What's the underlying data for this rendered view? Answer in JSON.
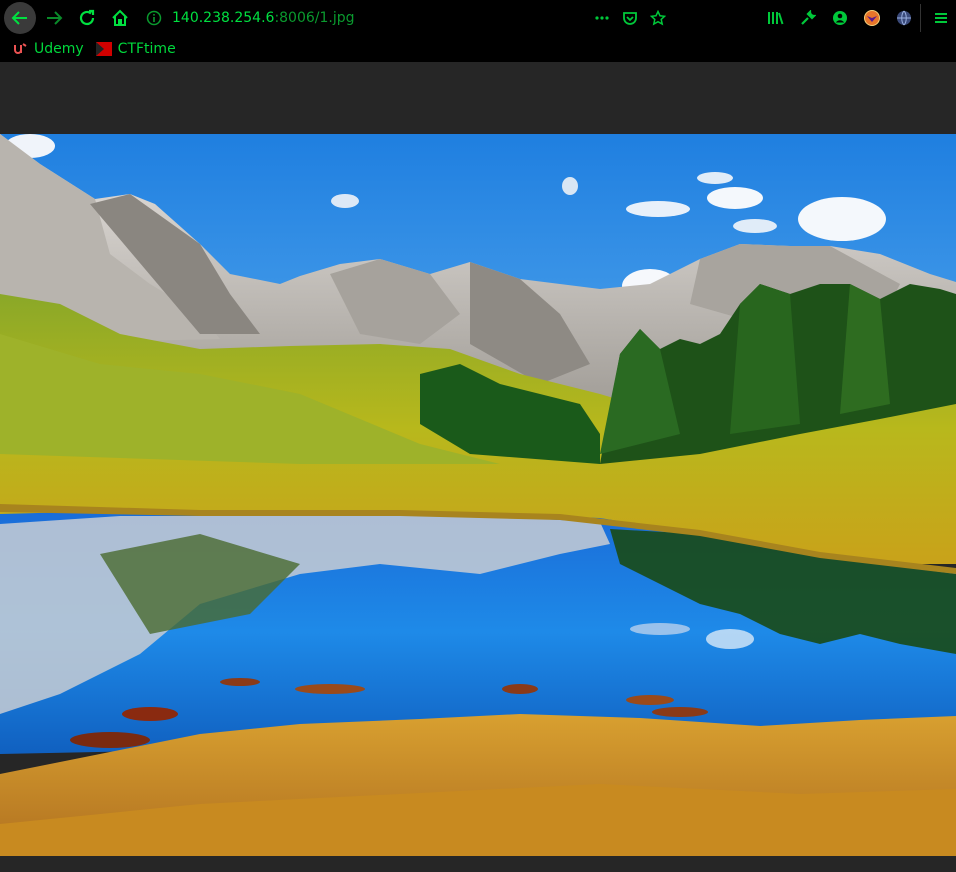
{
  "toolbar": {
    "url_host": "140.238.254.6",
    "url_rest": ":8006/1.jpg",
    "icons": [
      "back-arrow-icon",
      "forward-arrow-icon",
      "reload-icon",
      "home-icon",
      "info-icon",
      "more-dots-icon",
      "pocket-icon",
      "bookmark-star-icon",
      "library-icon",
      "wrench-icon",
      "account-icon",
      "extension-fox-icon",
      "extension-globe-icon",
      "hamburger-menu-icon"
    ]
  },
  "bookmarks": [
    {
      "label": "Udemy",
      "icon": "udemy-icon"
    },
    {
      "label": "CTFtime",
      "icon": "ctftime-flag-icon"
    }
  ],
  "colors": {
    "accent_green": "#00d83c",
    "toolbar_bg": "#000000",
    "page_bg": "#262626"
  }
}
